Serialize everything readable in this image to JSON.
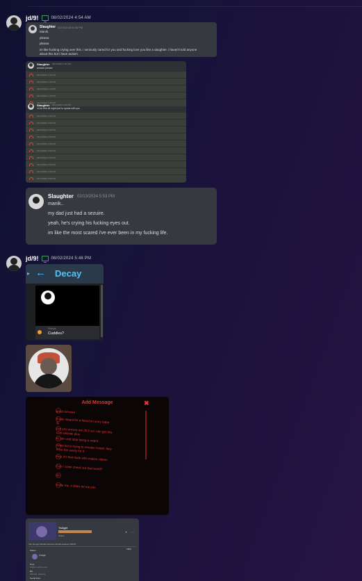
{
  "message1": {
    "username": "jd/9!",
    "timestamp": "08/02/2024 4:54 AM",
    "quoted": {
      "name": "Slaughter",
      "time": "02/13/2024 5:36 PM",
      "lines": [
        "Manik.",
        "please.",
        "please.",
        "im like fucking crying over this. i seriously cared for you and fucking love you like a daughter. i haven't told anyone",
        "about this but i have autism."
      ]
    },
    "log": {
      "name": "Slaughter",
      "time1": "02/13/2024 4:41 PM",
      "text1": "answer please",
      "time2": "02/13/2024 4:51 PM",
      "text2": "i'd do this all night just to speak with you",
      "rows_a": [
        "02/13/2024 4:44 PM",
        "02/13/2024 4:44 PM",
        "02/13/2024 4:44 PM",
        "02/13/2024 4:44 PM",
        "02/13/2024 4:45 PM"
      ],
      "rows_b": [
        "02/13/2024 4:52 PM",
        "02/13/2024 4:52 PM",
        "02/13/2024 4:52 PM",
        "02/13/2024 4:52 PM",
        "02/13/2024 4:53 PM",
        "02/13/2024 4:53 PM",
        "02/13/2024 4:53 PM",
        "02/13/2024 4:53 PM",
        "02/13/2024 4:53 PM",
        "02/13/2024 4:53 PM"
      ]
    },
    "large": {
      "name": "Slaughter",
      "time": "02/13/2024 5:53 PM",
      "lines": [
        "manik..",
        "my dad just had a sezuire.",
        "yeah, he's crying his fucking eyes out.",
        "im like the most scared i've ever been in my fucking life."
      ]
    }
  },
  "message2": {
    "username": "jd/9!",
    "timestamp": "08/02/2024 5:48 PM",
    "decay": {
      "title": "Decay",
      "footer_sub": "Friends",
      "footer_name": "Cuddles?"
    },
    "add_message": {
      "title": "Add Message",
      "close": "✖",
      "items": [
        "greet funnoke",
        "it was meant for a friend im sorry babe",
        "ily",
        "can you uncurp me 20.5 so i can get this",
        "cool website plus",
        "ez join and stop being a retard",
        "some kid is trying to remake hostel, they",
        "have the vanity for it",
        "Hey, it's that dude who makes videos",
        "Can I come check out that world?",
        "rip",
        "Invite me, it dides let me join."
      ]
    },
    "profile": {
      "name": "Twilight",
      "bio_line": "Online",
      "tabs": "Info    Groups    Worlds    Favorite Worlds    Avatars    VRCM",
      "section": "Status",
      "member_name": "Twilight",
      "note_label": "Note",
      "note_sub": "Click to add a note",
      "bio_label": "Bio",
      "bio_sub": "Wanted: aspiring",
      "links_label": "Social links",
      "right_value": "1984",
      "ctl_star": "✦",
      "ctl_more": "⋯"
    }
  }
}
